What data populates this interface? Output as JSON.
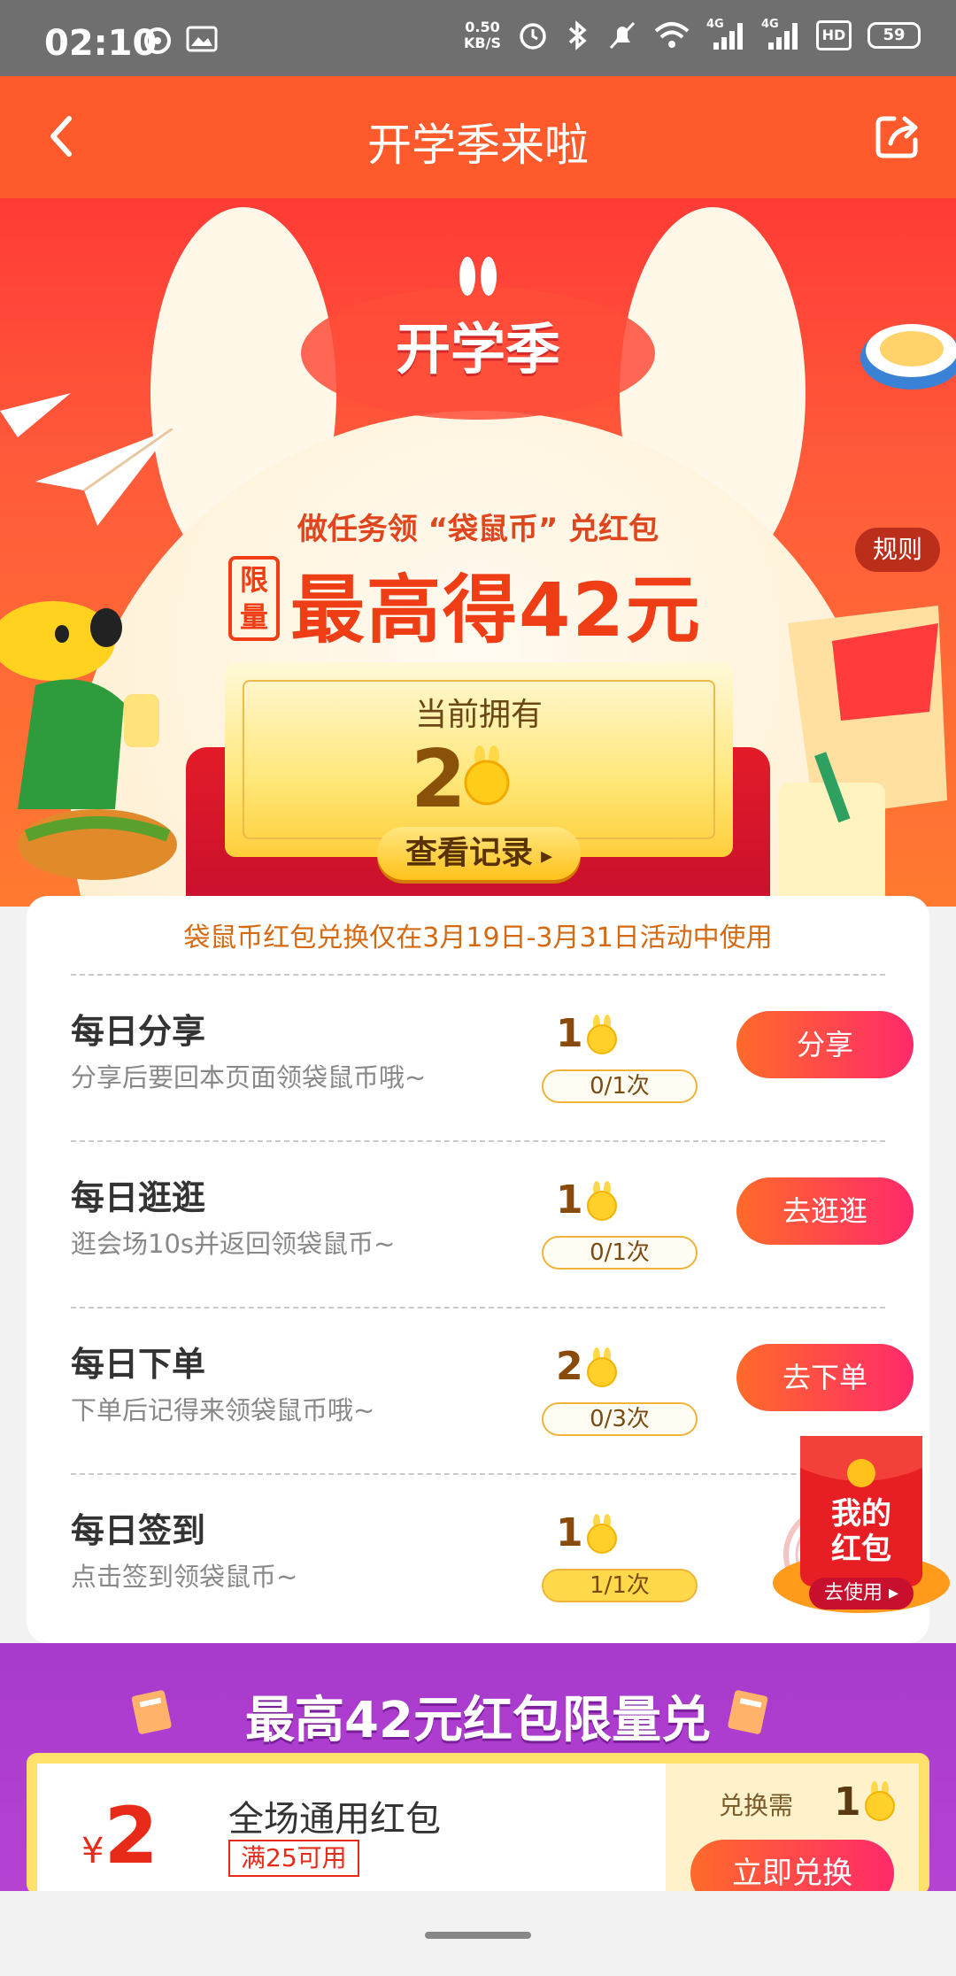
{
  "status_bar": {
    "time": "02:10",
    "speed_top": "0.50",
    "speed_bottom": "KB/S",
    "battery": "59",
    "net1": "4G",
    "net2": "4G",
    "hd": "HD"
  },
  "navbar": {
    "title": "开学季来啦"
  },
  "hero": {
    "logo": "开学季",
    "subtitle": "做任务领 “袋鼠币” 兑红包",
    "limit_badge": [
      "限",
      "量"
    ],
    "headline": "最高得42元",
    "rules": "规则",
    "current_label": "当前拥有",
    "current_count": "2",
    "record_button": "查看记录"
  },
  "tasks": {
    "notice": "袋鼠币红包兑换仅在3月19日-3月31日活动中使用",
    "items": [
      {
        "title": "每日分享",
        "desc": "分享后要回本页面领袋鼠币哦~",
        "reward": "1",
        "progress": "0/1次",
        "button": "分享"
      },
      {
        "title": "每日逛逛",
        "desc": "逛会场10s并返回领袋鼠币~",
        "reward": "1",
        "progress": "0/1次",
        "button": "去逛逛"
      },
      {
        "title": "每日下单",
        "desc": "下单后记得来领袋鼠币哦~",
        "reward": "2",
        "progress": "0/3次",
        "button": "去下单"
      },
      {
        "title": "每日签到",
        "desc": "点击签到领袋鼠币~",
        "reward": "1",
        "progress": "1/1次",
        "button": ""
      }
    ]
  },
  "floating_packet": {
    "line1": "我的",
    "line2": "红包",
    "action": "去使用"
  },
  "exchange_section": {
    "title": "最高42元红包限量兑",
    "coupon": {
      "currency": "¥",
      "amount": "2",
      "name": "全场通用红包",
      "condition": "满25可用",
      "need_label": "兑换需",
      "need_count": "1",
      "button": "立即兑换"
    }
  },
  "colors": {
    "navbar": "#ff5a2b",
    "accent": "#ef3d16",
    "button_gradient_start": "#ff6a2a",
    "button_gradient_end": "#ff2a6a",
    "exchange_bg": "#a73acc"
  }
}
